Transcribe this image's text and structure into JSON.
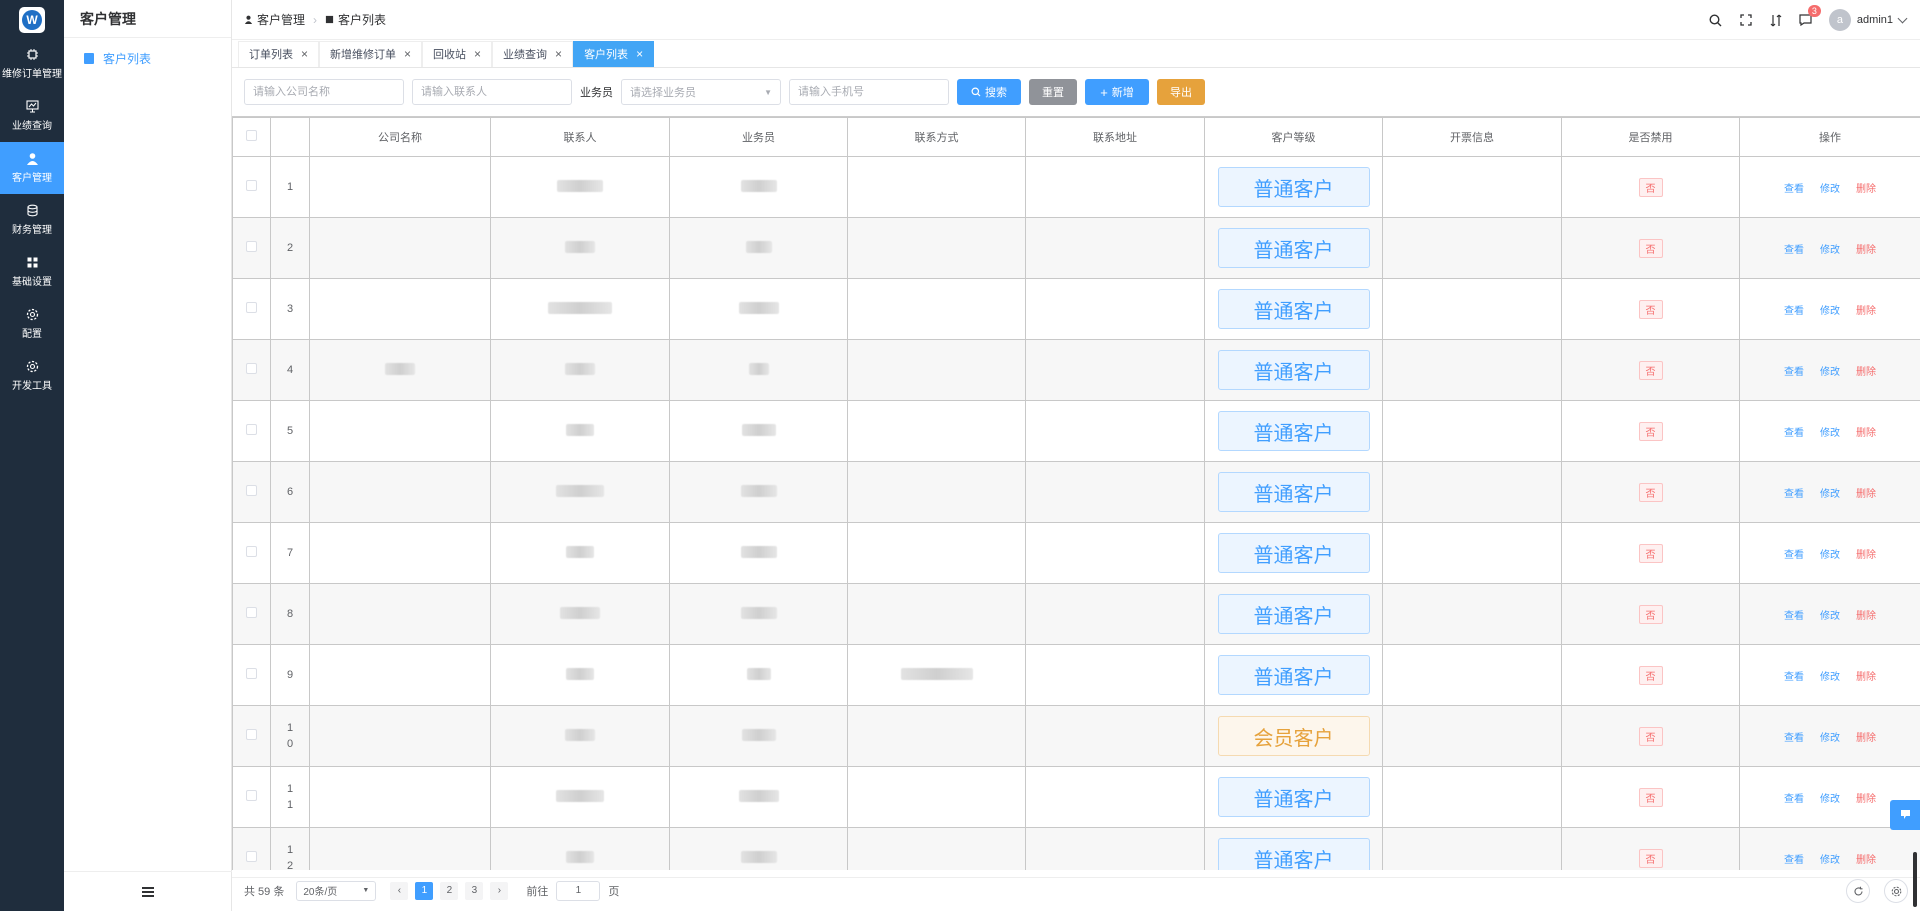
{
  "rail": {
    "items": [
      {
        "label": "维修订单管理",
        "icon": "chip-icon"
      },
      {
        "label": "业绩查询",
        "icon": "chart-icon"
      },
      {
        "label": "客户管理",
        "icon": "user-icon"
      },
      {
        "label": "财务管理",
        "icon": "database-icon"
      },
      {
        "label": "基础设置",
        "icon": "grid-icon"
      },
      {
        "label": "配置",
        "icon": "gear-icon"
      },
      {
        "label": "开发工具",
        "icon": "gear-icon"
      }
    ]
  },
  "subside": {
    "title": "客户管理",
    "menu_item": "客户列表"
  },
  "breadcrumb": {
    "parent": "客户管理",
    "current": "客户列表"
  },
  "header": {
    "badge_count": "3",
    "avatar_letter": "a",
    "username": "admin1"
  },
  "tabs": [
    {
      "label": "订单列表"
    },
    {
      "label": "新增维修订单"
    },
    {
      "label": "回收站"
    },
    {
      "label": "业绩查询"
    },
    {
      "label": "客户列表"
    }
  ],
  "search": {
    "company_placeholder": "请输入公司名称",
    "contact_placeholder": "请输入联系人",
    "salesman_label": "业务员",
    "salesman_placeholder": "请选择业务员",
    "phone_placeholder": "请输入手机号",
    "search_btn": "搜索",
    "reset_btn": "重置",
    "add_btn": "新增",
    "export_btn": "导出"
  },
  "table": {
    "columns": [
      "公司名称",
      "联系人",
      "业务员",
      "联系方式",
      "联系地址",
      "客户等级",
      "开票信息",
      "是否禁用",
      "操作"
    ],
    "ops": {
      "view": "查看",
      "edit": "修改",
      "delete": "删除"
    },
    "rows": [
      {
        "num": "1",
        "level": "普通客户",
        "vip": false,
        "disabled": "否"
      },
      {
        "num": "2",
        "level": "普通客户",
        "vip": false,
        "disabled": "否"
      },
      {
        "num": "3",
        "level": "普通客户",
        "vip": false,
        "disabled": "否"
      },
      {
        "num": "4",
        "level": "普通客户",
        "vip": false,
        "disabled": "否"
      },
      {
        "num": "5",
        "level": "普通客户",
        "vip": false,
        "disabled": "否"
      },
      {
        "num": "6",
        "level": "普通客户",
        "vip": false,
        "disabled": "否"
      },
      {
        "num": "7",
        "level": "普通客户",
        "vip": false,
        "disabled": "否"
      },
      {
        "num": "8",
        "level": "普通客户",
        "vip": false,
        "disabled": "否"
      },
      {
        "num": "9",
        "level": "普通客户",
        "vip": false,
        "disabled": "否"
      },
      {
        "num": "10",
        "level": "会员客户",
        "vip": true,
        "disabled": "否"
      },
      {
        "num": "11",
        "level": "普通客户",
        "vip": false,
        "disabled": "否"
      },
      {
        "num": "12",
        "level": "普通客户",
        "vip": false,
        "disabled": "否"
      }
    ]
  },
  "pager": {
    "total": "共 59 条",
    "page_size": "20条/页",
    "pages": [
      "1",
      "2",
      "3"
    ],
    "goto_label": "前往",
    "goto_value": "1",
    "page_suffix": "页"
  }
}
